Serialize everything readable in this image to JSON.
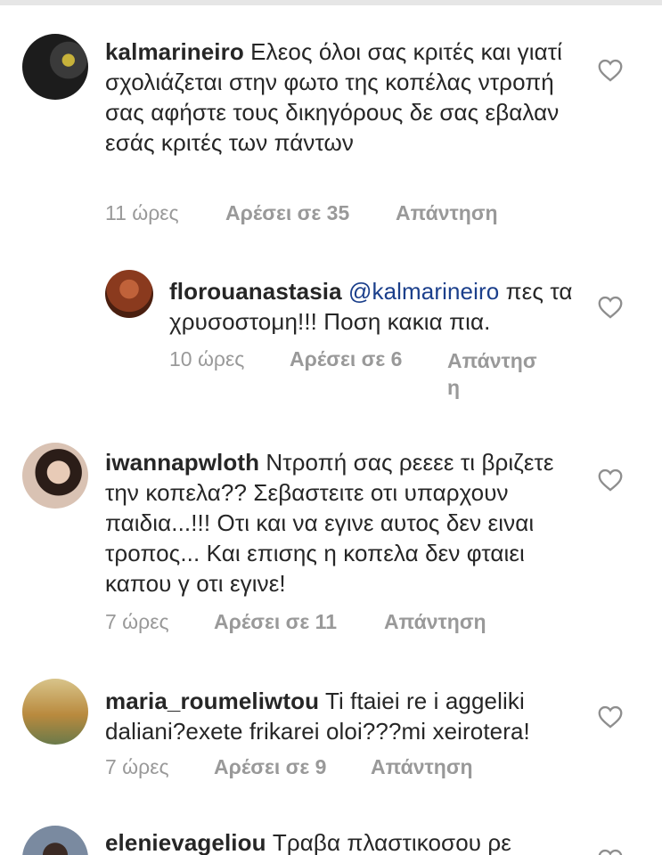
{
  "comments": [
    {
      "username": "kalmarineiro",
      "text": "Ελεος όλοι σας κριτές και γιατί σχολιάζεται στην φωτο της κοπέλας ντροπή σας αφήστε τους δικηγόρους δε σας εβαλαν εσάς κριτές των πάντων",
      "time": "11 ώρες",
      "likes": "Αρέσει σε 35",
      "reply": "Απάντηση",
      "avatar_color": "#2a2a2a"
    },
    {
      "username": "florouanastasia",
      "mention": "@kalmarineiro",
      "text": "πες τα χρυσοστομη!!! Ποση κακια πια.",
      "time": "10 ώρες",
      "likes": "Αρέσει σε 6",
      "reply": "Απάντηση",
      "avatar_color": "#8a3a1e"
    },
    {
      "username": "iwannapwloth",
      "text": "Ντροπή σας ρεεεε τι βριζετε την κοπελα?? Σεβαστειτε οτι υπαρχουν παιδια...!!! Οτι και να εγινε αυτος δεν ειναι τροπος... Και επισης η κοπελα δεν φταιει καπου γ οτι εγινε!",
      "time": "7 ώρες",
      "likes": "Αρέσει σε 11",
      "reply": "Απάντηση",
      "avatar_color": "#caa58e"
    },
    {
      "username": "maria_roumeliwtou",
      "text": "Ti ftaiei re i aggeliki daliani?exete frikarei oloi???mi xeirotera!",
      "time": "7 ώρες",
      "likes": "Αρέσει σε 9",
      "reply": "Απάντηση",
      "avatar_color": "#b98a3e"
    },
    {
      "username": "elenievageliou",
      "text": "Τραβα πλαστικοσου ρε",
      "avatar_color": "#7a8aa0"
    }
  ],
  "colors": {
    "text": "#262626",
    "meta": "#999999",
    "mention": "#1b3f8b"
  },
  "icons": {
    "like": "heart-outline-icon"
  }
}
